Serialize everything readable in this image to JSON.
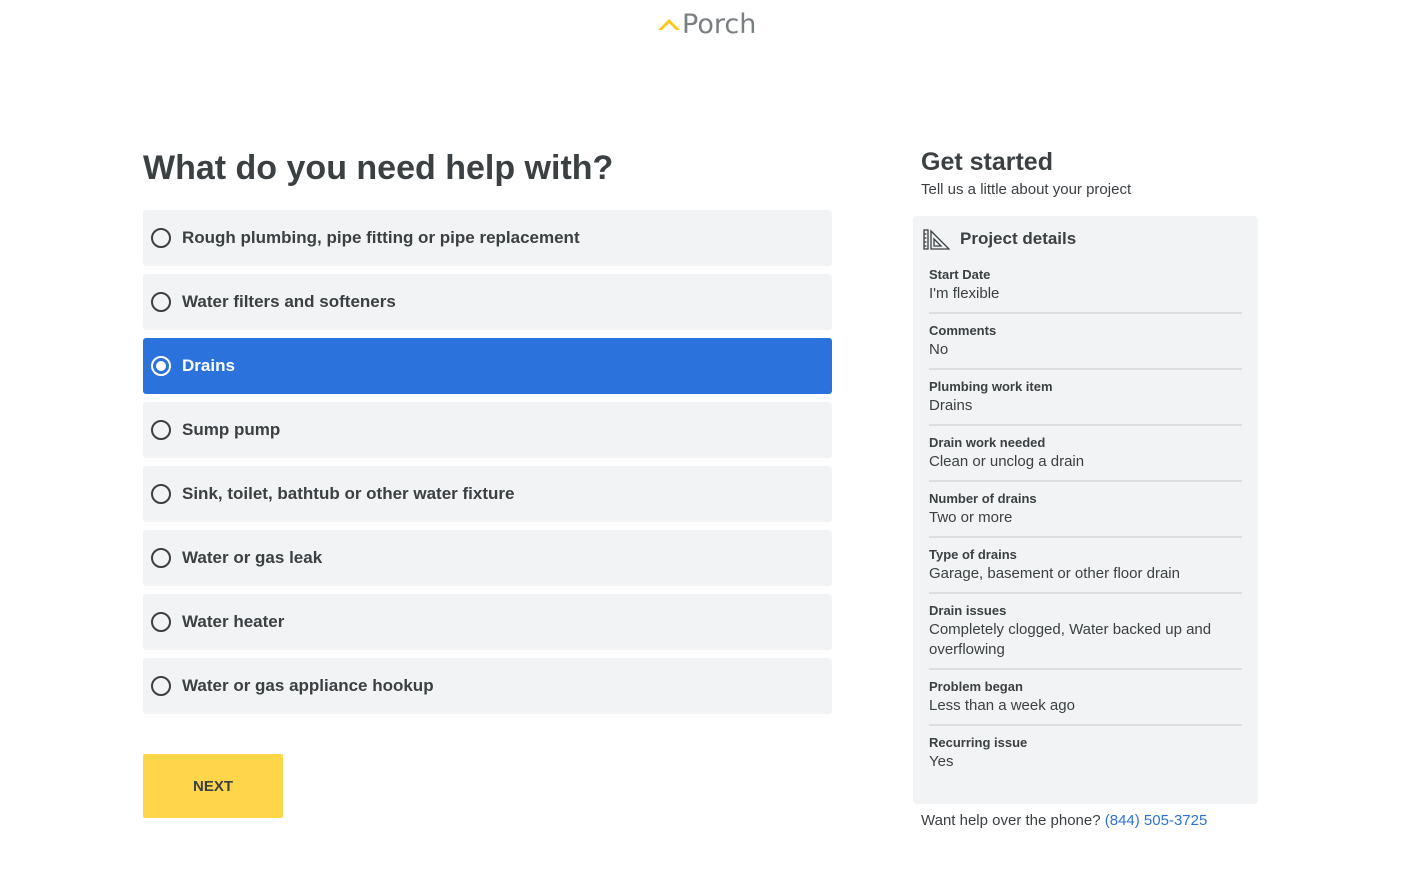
{
  "brand": {
    "name": "Porch",
    "accent": "#ffc61a"
  },
  "question": {
    "title": "What do you need help with?",
    "options": [
      {
        "label": "Rough plumbing, pipe fitting or pipe replacement",
        "selected": false
      },
      {
        "label": "Water filters and softeners",
        "selected": false
      },
      {
        "label": "Drains",
        "selected": true
      },
      {
        "label": "Sump pump",
        "selected": false
      },
      {
        "label": "Sink, toilet, bathtub or other water fixture",
        "selected": false
      },
      {
        "label": "Water or gas leak",
        "selected": false
      },
      {
        "label": "Water heater",
        "selected": false
      },
      {
        "label": "Water or gas appliance hookup",
        "selected": false
      }
    ],
    "selected_color": "#2c72dd",
    "next_label": "NEXT",
    "next_color": "#ffd54a"
  },
  "sidebar": {
    "title": "Get started",
    "subtitle": "Tell us a little about your project",
    "panel_title": "Project details",
    "panel_icon": "ruler-triangle-icon",
    "details": [
      {
        "label": "Start Date",
        "value": "I'm flexible"
      },
      {
        "label": "Comments",
        "value": "No"
      },
      {
        "label": "Plumbing work item",
        "value": "Drains"
      },
      {
        "label": "Drain work needed",
        "value": "Clean or unclog a drain"
      },
      {
        "label": "Number of drains",
        "value": "Two or more"
      },
      {
        "label": "Type of drains",
        "value": "Garage, basement or other floor drain"
      },
      {
        "label": "Drain issues",
        "value": "Completely clogged, Water backed up and overflowing"
      },
      {
        "label": "Problem began",
        "value": "Less than a week ago"
      },
      {
        "label": "Recurring issue",
        "value": "Yes"
      }
    ],
    "phone_prompt": "Want help over the phone?",
    "phone_number": "(844) 505-3725"
  }
}
